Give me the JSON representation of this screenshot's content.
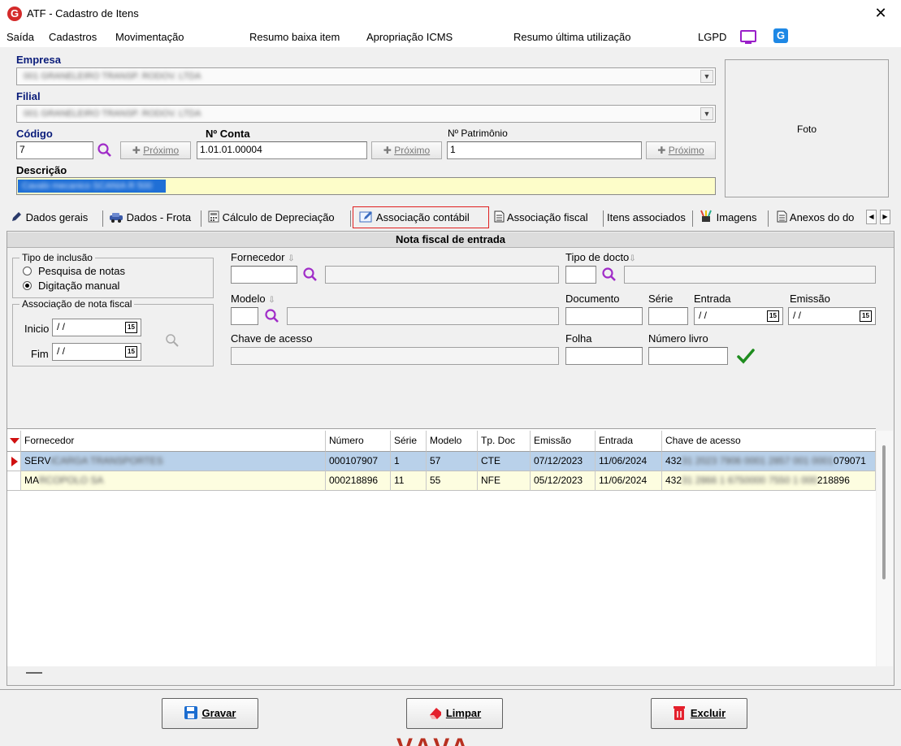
{
  "window": {
    "title": "ATF - Cadastro de Itens",
    "close_glyph": "✕",
    "logo_letter": "G"
  },
  "menu": {
    "items": [
      "Saída",
      "Cadastros",
      "Movimentação",
      "Resumo baixa item",
      "Apropriação ICMS",
      "Resumo última utilização",
      "LGPD"
    ],
    "icons": [
      "monitor-icon",
      "g-app-icon"
    ]
  },
  "form": {
    "empresa_label": "Empresa",
    "empresa_value": "001 GRANELEIRO TRANSP. RODOV. LTDA",
    "filial_label": "Filial",
    "filial_value": "001 GRANELEIRO TRANSP. RODOV. LTDA",
    "codigo_label": "Código",
    "codigo_value": "7",
    "proximo_label": "Próximo",
    "conta_label": "Nº Conta",
    "conta_value": "1.01.01.00004",
    "patrimonio_label": "Nº Patrimônio",
    "patrimonio_value": "1",
    "descricao_label": "Descrição",
    "descricao_value": "Cavalo mecanico SCANIA R 500",
    "foto_label": "Foto"
  },
  "tabs": {
    "items": [
      "Dados gerais",
      "Dados - Frota",
      "Cálculo de Depreciação",
      "Associação contábil",
      "Associação fiscal",
      "Itens associados",
      "Imagens",
      "Anexos do do"
    ],
    "active": "Associação contábil",
    "scroll_left": "◀",
    "scroll_right": "▶"
  },
  "nf": {
    "header": "Nota fiscal de entrada",
    "tipo_inclusao_title": "Tipo de inclusão",
    "radio_pesquisa": "Pesquisa de notas",
    "radio_digitacao": "Digitação manual",
    "selected_radio": "Digitação manual",
    "associacao_title": "Associação de nota fiscal",
    "inicio_label": "Inicio",
    "fim_label": "Fim",
    "date_placeholder": "/ /",
    "cal_text": "15",
    "fornecedor_label": "Fornecedor",
    "tipo_docto_label": "Tipo de docto",
    "modelo_label": "Modelo",
    "documento_label": "Documento",
    "serie_label": "Série",
    "entrada_label": "Entrada",
    "emissao_label": "Emissão",
    "chave_label": "Chave de acesso",
    "folha_label": "Folha",
    "numero_livro_label": "Número livro",
    "sort_arrow": "⇩"
  },
  "grid": {
    "columns": [
      "Fornecedor",
      "Número",
      "Série",
      "Modelo",
      "Tp. Doc",
      "Emissão",
      "Entrada",
      "Chave de acesso"
    ],
    "rows": [
      {
        "fornecedor_start": "SERV",
        "fornecedor_blur": "ICARGA TRANSPORTES",
        "numero": "000107907",
        "serie": "1",
        "modelo": "57",
        "tpdoc": "CTE",
        "emissao": "07/12/2023",
        "entrada": "11/06/2024",
        "chave_start": "432",
        "chave_blur": "31 2023 7906 0001 2857 001 0001",
        "chave_end": "079071"
      },
      {
        "fornecedor_start": "MA",
        "fornecedor_blur": "RCOPOLO SA",
        "numero": "000218896",
        "serie": "11",
        "modelo": "55",
        "tpdoc": "NFE",
        "emissao": "05/12/2023",
        "entrada": "11/06/2024",
        "chave_start": "432",
        "chave_blur": "31 2866 1 6750000 7550 1 000",
        "chave_end": "218896"
      }
    ],
    "selected_row": 0
  },
  "footer": {
    "gravar": "Gravar",
    "limpar": "Limpar",
    "excluir": "Excluir",
    "watermark": "VAVA"
  },
  "colors": {
    "accent_red": "#e02020",
    "label_blue": "#0a1c7a",
    "search_purple": "#a02cc8",
    "check_green": "#1e8c1e",
    "selection_blue": "#b9d1ea",
    "desc_yellow": "#fdfdc9"
  }
}
